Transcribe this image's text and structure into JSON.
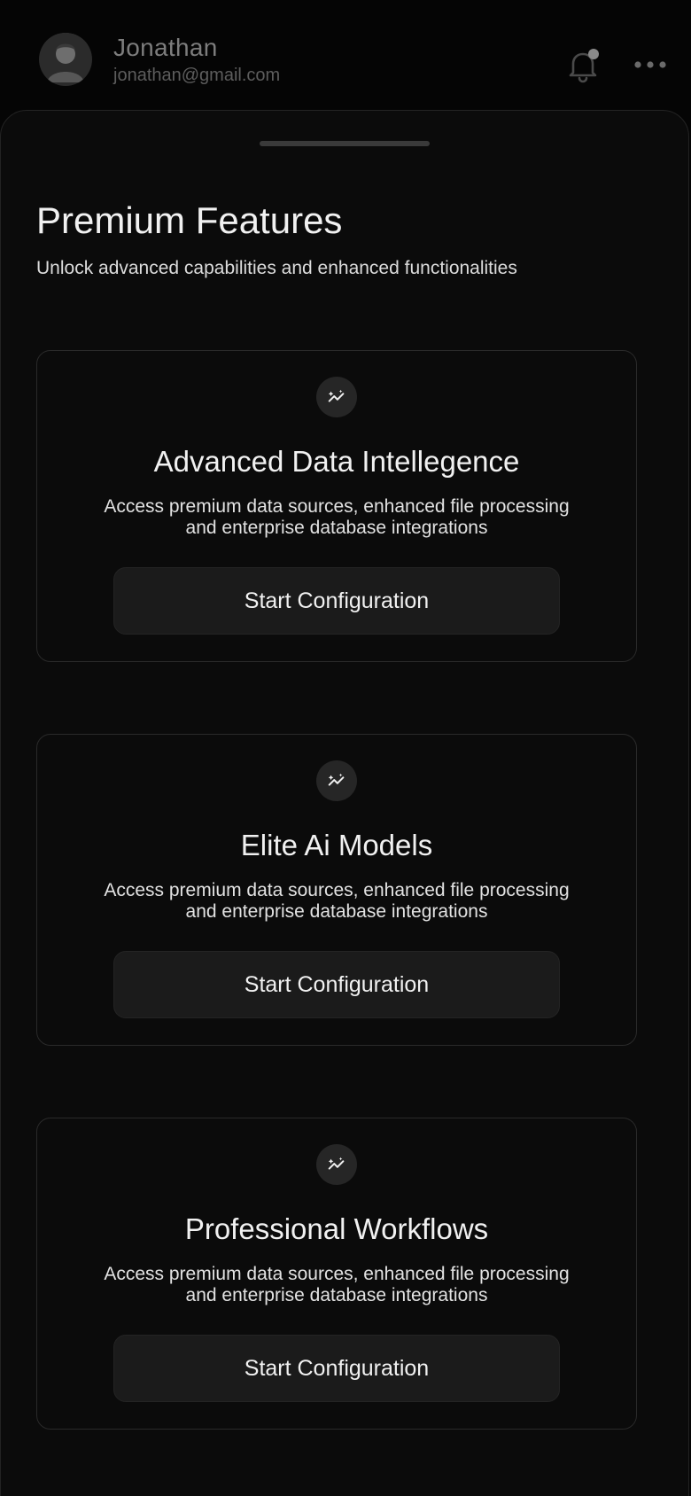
{
  "user": {
    "name": "Jonathan",
    "email": "jonathan@gmail.com",
    "notification_dot": true
  },
  "header": {
    "bell_icon": "bell-icon",
    "more_icon": "more-horizontal-icon"
  },
  "sheet": {
    "title": "Premium Features",
    "subtitle": "Unlock advanced capabilities and enhanced functionalities"
  },
  "features": [
    {
      "icon": "sparkle-trend-icon",
      "title": "Advanced Data Intellegence",
      "description": "Access premium data sources, enhanced file processing and enterprise database integrations",
      "button_label": "Start Configuration"
    },
    {
      "icon": "sparkle-trend-icon",
      "title": "Elite Ai Models",
      "description": "Access premium data sources, enhanced file processing and enterprise database integrations",
      "button_label": "Start Configuration"
    },
    {
      "icon": "sparkle-trend-icon",
      "title": "Professional Workflows",
      "description": "Access premium data sources, enhanced file processing and enterprise database integrations",
      "button_label": "Start Configuration"
    }
  ],
  "colors": {
    "background": "#050505",
    "sheet": "#0b0b0b",
    "card_border": "#2a2a2a",
    "button_bg": "#1b1b1b",
    "text_primary": "#f1f1f1",
    "text_muted": "#7d7d7d"
  }
}
